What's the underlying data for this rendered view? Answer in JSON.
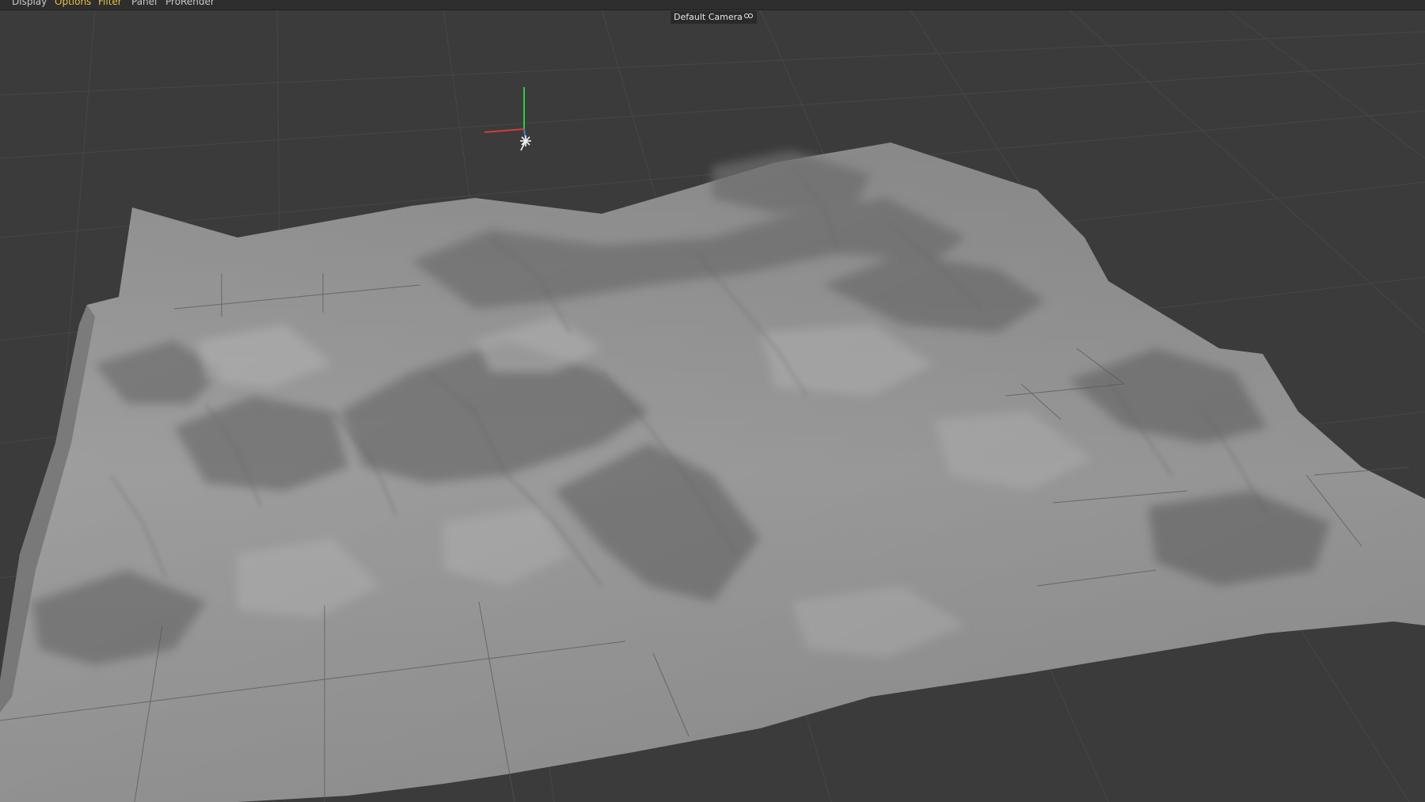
{
  "menu": {
    "items": [
      {
        "id": "display",
        "label": "Display",
        "active": false
      },
      {
        "id": "options",
        "label": "Options",
        "active": true
      },
      {
        "id": "filter",
        "label": "Filter",
        "active": true
      },
      {
        "id": "panel",
        "label": "Panel",
        "active": false
      },
      {
        "id": "prorender",
        "label": "ProRender",
        "active": false
      }
    ]
  },
  "viewport": {
    "camera_label": "Default Camera",
    "camera_icon": "camera-icon",
    "background_color": "#3b3b3b",
    "terrain_color": "#9a9a9a",
    "gizmo": {
      "y_axis_color": "#2ecc40",
      "x_axis_color": "#d63a3a",
      "light_icon": "light-icon"
    }
  }
}
